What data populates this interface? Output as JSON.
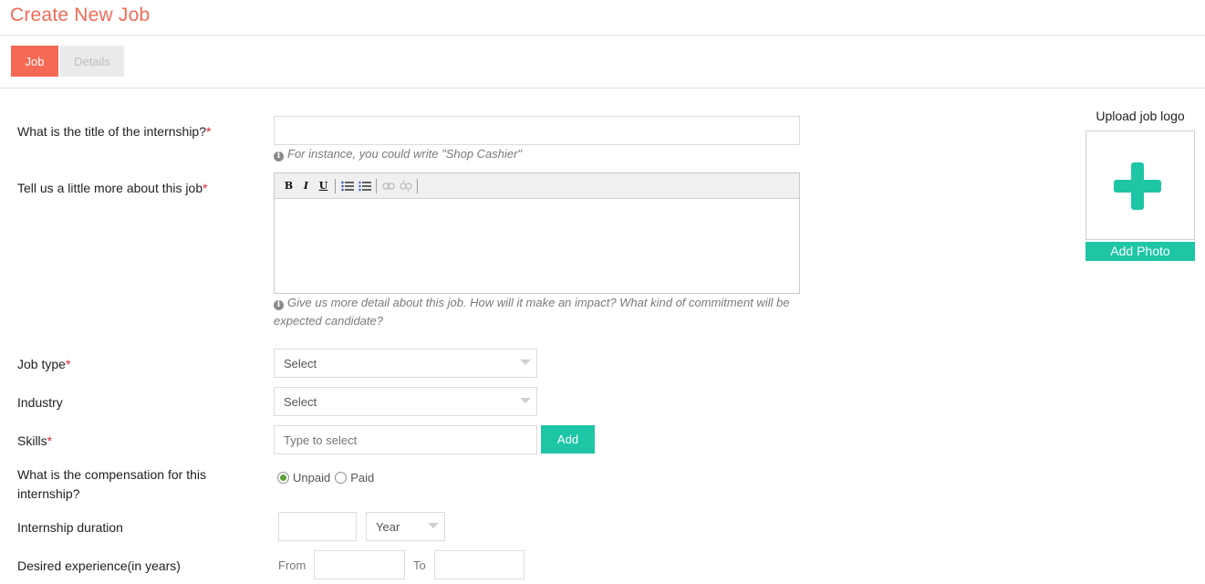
{
  "page": {
    "title": "Create New Job"
  },
  "tabs": [
    {
      "label": "Job"
    },
    {
      "label": "Details"
    }
  ],
  "form": {
    "title_field": {
      "label": "What is the title of the internship?",
      "required_mark": "*",
      "value": "",
      "hint": "For instance, you could write \"Shop Cashier\""
    },
    "description_field": {
      "label": "Tell us a little more about this job",
      "required_mark": "*",
      "toolbar": {
        "bold": "B",
        "italic": "I",
        "underline": "U"
      },
      "value": "",
      "hint": "Give us more detail about this job. How will it make an impact? What kind of commitment will be expected candidate?"
    },
    "job_type": {
      "label": "Job type",
      "required_mark": "*",
      "selected": "Select"
    },
    "industry": {
      "label": "Industry",
      "selected": "Select"
    },
    "skills": {
      "label": "Skills",
      "required_mark": "*",
      "placeholder": "Type to select",
      "add_label": "Add"
    },
    "compensation": {
      "label": "What is the compensation for this internship?",
      "options": [
        {
          "label": "Unpaid",
          "checked": true
        },
        {
          "label": "Paid",
          "checked": false
        }
      ]
    },
    "duration": {
      "label": "Internship duration",
      "value": "",
      "unit_selected": "Year"
    },
    "experience": {
      "label": "Desired experience(in years)",
      "from_label": "From",
      "to_label": "To",
      "from_value": "",
      "to_value": ""
    }
  },
  "logo_upload": {
    "title": "Upload job logo",
    "button_label": "Add Photo",
    "accent": "#1ec6a6"
  },
  "colors": {
    "accent": "#f56a54",
    "teal": "#1ec6a6",
    "required": "#e0262f"
  }
}
